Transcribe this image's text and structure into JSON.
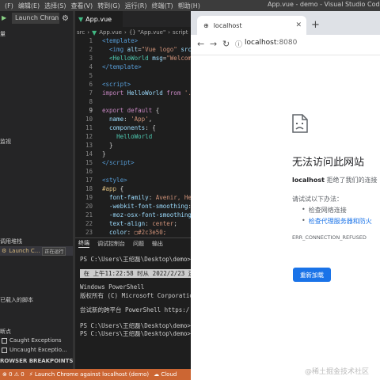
{
  "menubar": {
    "items": [
      "(F)",
      "编辑(E)",
      "选择(S)",
      "查看(V)",
      "转到(G)",
      "运行(R)",
      "终端(T)",
      "帮助(H)"
    ],
    "window_title": "App.vue - demo - Visual Studio Code"
  },
  "sidebar": {
    "launch_config": "Launch Chron",
    "variables_head": "量",
    "watch_head": "监视",
    "callstack_head": "调用堆栈",
    "callstack_item": "Launch C...",
    "callstack_badge": "正在运行",
    "loaded_scripts_head": "已载入的脚本",
    "breakpoints_head": "断点",
    "caught_exceptions": "Caught Exceptions",
    "uncaught_exceptions": "Uncaught Exceptio...",
    "browser_breakpoints": "ROWSER BREAKPOINTS"
  },
  "editor": {
    "tab_label": "App.vue",
    "breadcrumb": [
      "src",
      "App.vue",
      "{} \"App.vue\"",
      "script"
    ],
    "line_numbers": [
      "1",
      "2",
      "3",
      "4",
      "5",
      "6",
      "7",
      "8",
      "9",
      "10",
      "11",
      "12",
      "13",
      "14",
      "15",
      "16",
      "17",
      "18",
      "19",
      "20",
      "21",
      "22",
      "23"
    ],
    "current_line": "9"
  },
  "panel": {
    "tabs": [
      "终端",
      "调试控制台",
      "问题",
      "输出"
    ]
  },
  "terminal": {
    "lines": [
      "PS C:\\Users\\王绍磊\\Desktop\\demo>",
      "",
      " 在 上午11:22:58 时从 2022/2/23 还",
      "",
      "Windows PowerShell",
      "版权所有 (C) Microsoft Corporation",
      "",
      "尝试新的跨平台 PowerShell https:/",
      "",
      "PS C:\\Users\\王绍磊\\Desktop\\demo>",
      "PS C:\\Users\\王绍磊\\Desktop\\demo>"
    ]
  },
  "statusbar": {
    "items": [
      "⊗ 0 ⚠ 0",
      "⚡ Launch Chrome against localhost (demo)",
      "☁ Cloud"
    ]
  },
  "browser": {
    "tab_title": "localhost",
    "url_host": "localhost",
    "url_port": ":8080",
    "error_title": "无法访问此网站",
    "error_host": "localhost",
    "error_rest": " 拒绝了我们的连接",
    "try_heading": "请试试以下办法：",
    "try_items": [
      "检查网络连接",
      "检查代理服务器和防火"
    ],
    "error_code": "ERR_CONNECTION_REFUSED",
    "reload_label": "重新加载",
    "watermark": "@稀土掘金技术社区"
  },
  "colors": {
    "statusbar": "#cc6633",
    "accent_blue": "#1a73e8",
    "vue_green": "#41b883"
  }
}
